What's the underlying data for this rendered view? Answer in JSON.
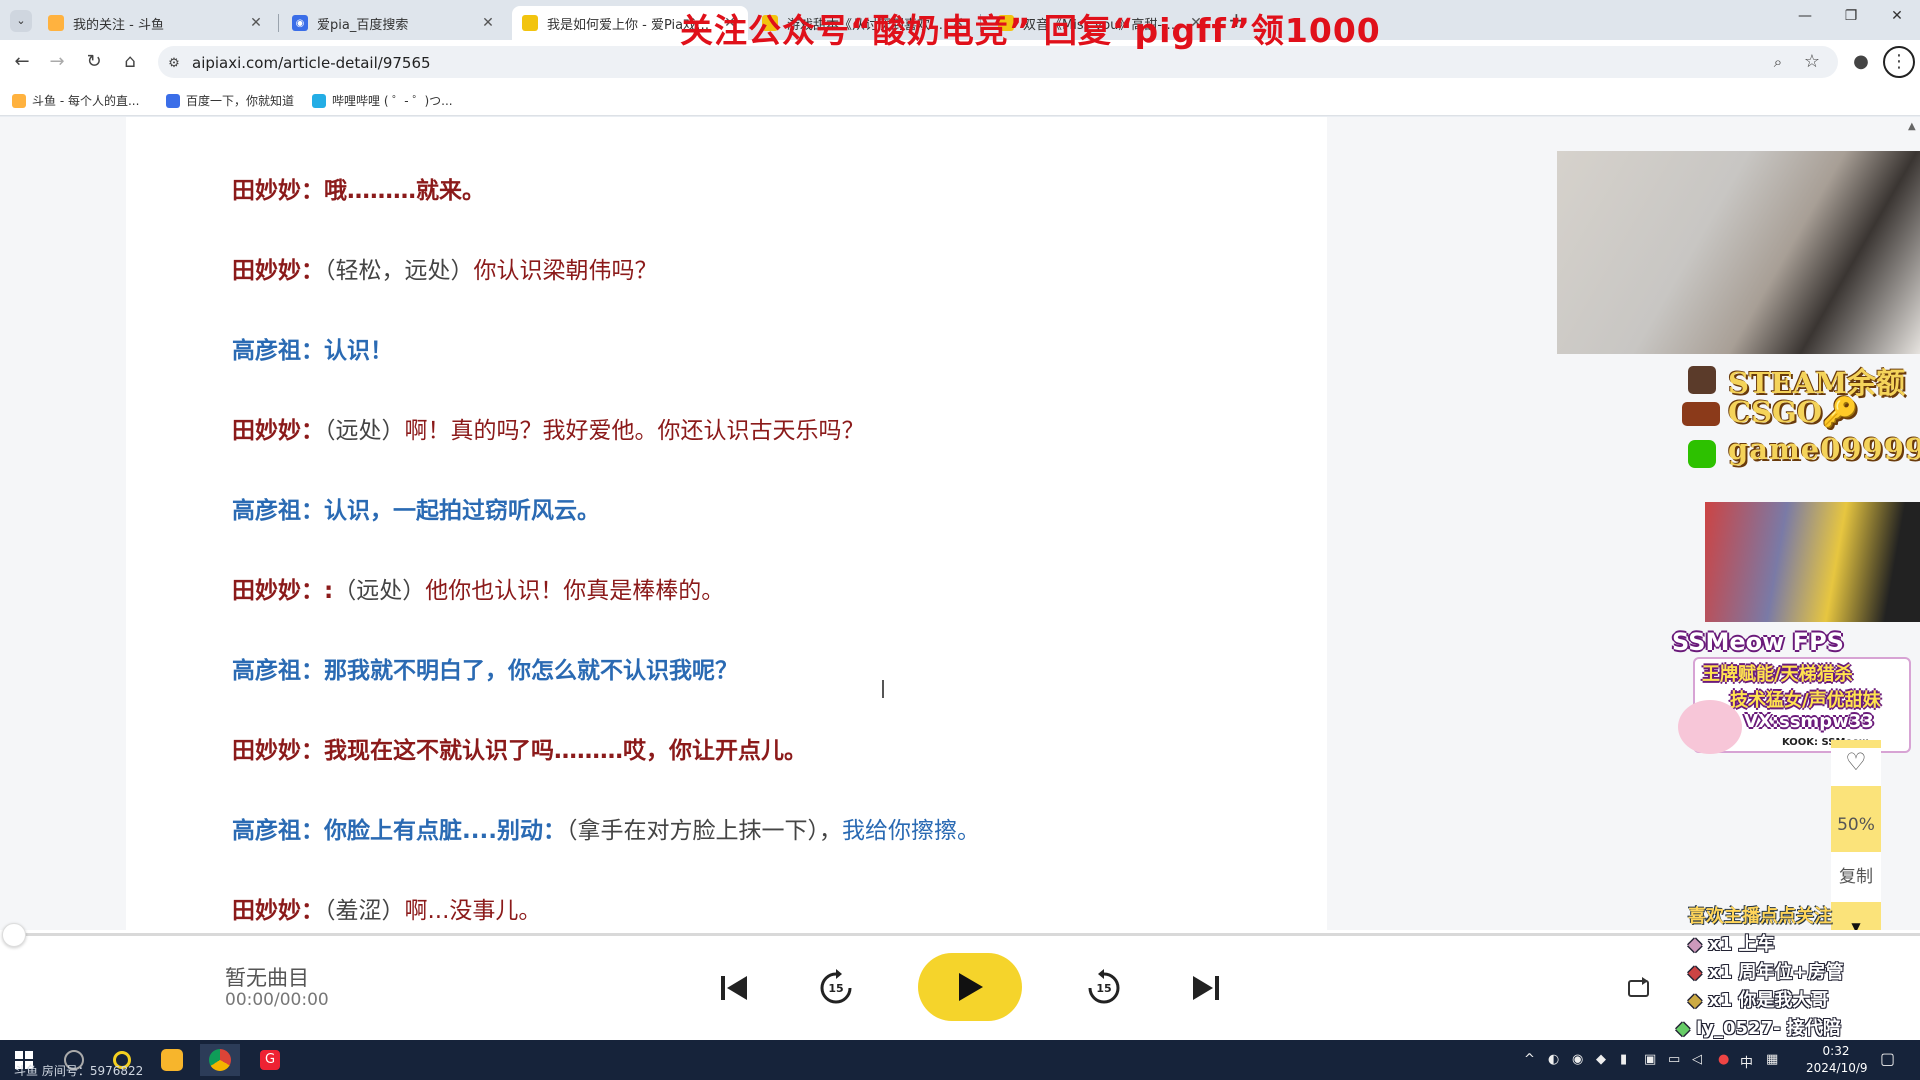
{
  "browser": {
    "tabs": [
      {
        "title": "我的关注 - 斗鱼",
        "active": false
      },
      {
        "title": "爱pia_百度搜索",
        "active": false
      },
      {
        "title": "我是如何爱上你 - 爱Pia戏网,戏",
        "active": true
      },
      {
        "title": "游戏甜本《从讨厌到喜欢》- 爱",
        "active": false
      },
      {
        "title": "双音《Miss you》高甜-米米曲",
        "active": false
      }
    ],
    "new_tab": "+",
    "url": "aipiaxi.com/article-detail/97565",
    "bookmarks": [
      "斗鱼 - 每个人的直...",
      "百度一下，你就知道",
      "哔哩哔哩 ( ゜- ゜)つ..."
    ]
  },
  "article": {
    "promo": "关注公众号“酸奶电竞” 回复“pigff”领1000",
    "lines": [
      {
        "speaker": "田妙妙：",
        "role": "tian",
        "paren": "",
        "text": "哦………就来。"
      },
      {
        "speaker": "田妙妙：",
        "role": "tian",
        "paren": "（轻松，远处）",
        "text": "你认识梁朝伟吗？"
      },
      {
        "speaker": "高彦祖：",
        "role": "gao",
        "paren": "",
        "text": "认识！"
      },
      {
        "speaker": "田妙妙：",
        "role": "tian",
        "paren": "（远处）",
        "text": "啊！真的吗？我好爱他。你还认识古天乐吗？"
      },
      {
        "speaker": "高彦祖：",
        "role": "gao",
        "paren": "",
        "text": "认识，一起拍过窃听风云。"
      },
      {
        "speaker": "田妙妙：:",
        "role": "tian",
        "paren": "（远处）",
        "text": "他你也认识！你真是棒棒的。"
      },
      {
        "speaker": "高彦祖：",
        "role": "gao",
        "paren": "",
        "text": "那我就不明白了，你怎么就不认识我呢？"
      },
      {
        "speaker": "田妙妙：",
        "role": "tian",
        "paren": "",
        "text": "我现在这不就认识了吗………哎，你让开点儿。"
      },
      {
        "speaker": "高彦祖：",
        "role": "gao",
        "paren": "",
        "text": "你脸上有点脏....别动：",
        "paren2": "（拿手在对方脸上抹一下），",
        "text2": "我给你擦擦。"
      },
      {
        "speaker": "田妙妙：",
        "role": "tian",
        "paren": "（羞涩）",
        "text": "啊...没事儿。"
      }
    ]
  },
  "overlay": {
    "ad_lines": [
      "STEAM余额",
      "CSGO🔑",
      "game09999"
    ],
    "ss_title": "SSMeow FPS",
    "ss_lines": [
      "王牌赋能/天梯猎杀",
      "技术猛女/声优甜妹",
      "VX:ssmpw33"
    ],
    "ss_kook": "KOOK: SSMeow",
    "follow": "喜欢主播点点关注",
    "gifts": [
      "x1 上车",
      "x1 周年位+房管",
      "x1 你是我大哥",
      "ly_0527- 接代陪"
    ]
  },
  "side_panel": {
    "zoom": "50%",
    "copy": "复制"
  },
  "player": {
    "track": "暂无曲目",
    "time": "00:00/00:00",
    "skip_back": "15",
    "skip_fwd": "15"
  },
  "taskbar": {
    "room": "斗鱼 房间号：5976822",
    "ime": "中",
    "time": "0:32",
    "date": "2024/10/9"
  },
  "colors": {
    "tian": "#8b1a1a",
    "gao": "#2a6ab3",
    "promo": "#e0101a",
    "play": "#f5d42b"
  }
}
